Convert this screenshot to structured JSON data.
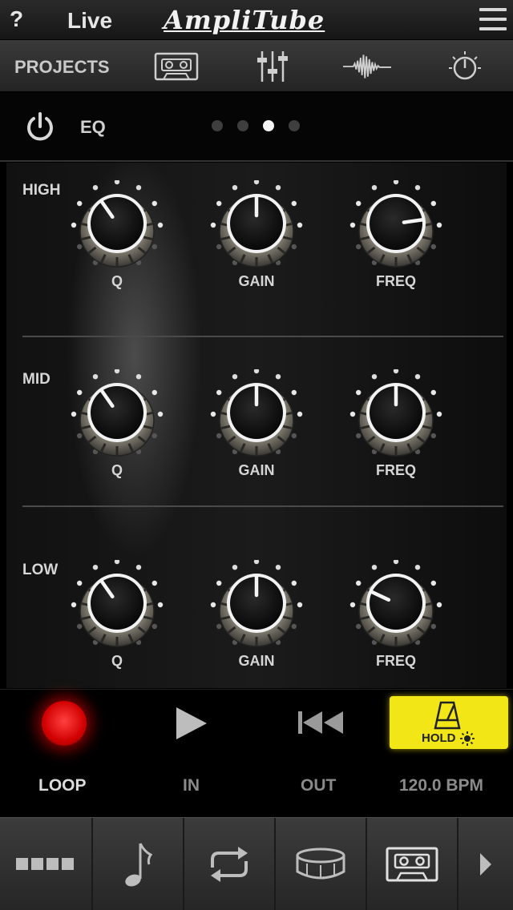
{
  "header": {
    "help": "?",
    "mode": "Live",
    "logo": "AmpliTube"
  },
  "nav": {
    "projects": "PROJECTS",
    "icons": [
      "cassette-icon",
      "mixer-faders-icon",
      "waveform-icon",
      "tuner-dial-icon"
    ]
  },
  "module": {
    "name": "EQ",
    "page_count": 4,
    "active_page": 3
  },
  "eq": {
    "bands": [
      {
        "name": "HIGH",
        "knobs": [
          {
            "label": "Q"
          },
          {
            "label": "GAIN"
          },
          {
            "label": "FREQ"
          }
        ]
      },
      {
        "name": "MID",
        "knobs": [
          {
            "label": "Q"
          },
          {
            "label": "GAIN"
          },
          {
            "label": "FREQ"
          }
        ]
      },
      {
        "name": "LOW",
        "knobs": [
          {
            "label": "Q"
          },
          {
            "label": "GAIN"
          },
          {
            "label": "FREQ"
          }
        ]
      }
    ]
  },
  "transport": {
    "hold": "HOLD",
    "loop": "LOOP",
    "in": "IN",
    "out": "OUT",
    "bpm": "120.0 BPM"
  },
  "colors": {
    "record": "#e00000",
    "hold": "#f2e617",
    "background": "#000000"
  }
}
